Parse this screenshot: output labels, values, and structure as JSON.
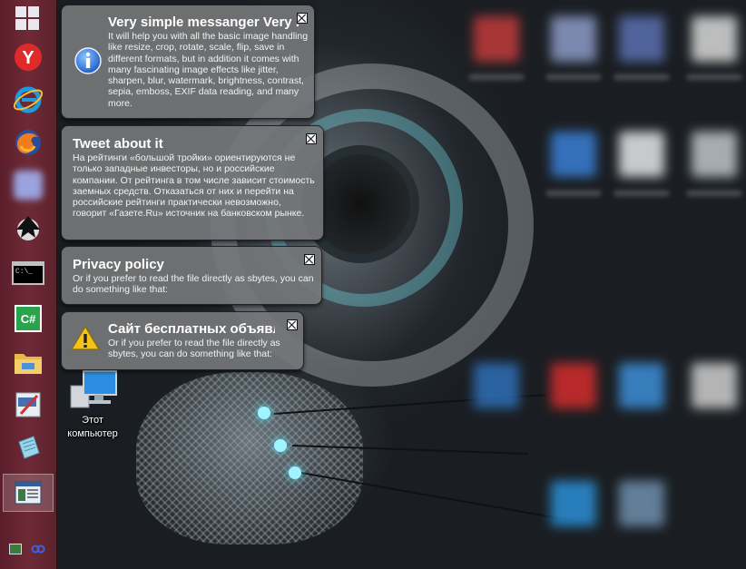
{
  "taskbar": {
    "items": [
      {
        "name": "yandex-browser",
        "icon": "yandex-icon"
      },
      {
        "name": "internet-explorer",
        "icon": "ie-icon"
      },
      {
        "name": "firefox",
        "icon": "firefox-icon"
      },
      {
        "name": "blurred-app",
        "icon": "app-icon"
      },
      {
        "name": "inkscape",
        "icon": "inkscape-icon"
      },
      {
        "name": "command-prompt",
        "icon": "cmd-icon"
      },
      {
        "name": "csharp-editor",
        "icon": "csharp-icon"
      },
      {
        "name": "file-explorer",
        "icon": "folder-icon"
      },
      {
        "name": "image-editor",
        "icon": "editor-icon"
      },
      {
        "name": "notepad",
        "icon": "notepad-icon"
      },
      {
        "name": "messenger-window",
        "icon": "window-icon"
      }
    ],
    "cmd_text": "C:\\_",
    "csharp_text": "C#"
  },
  "desktop": {
    "computer_label_line1": "Этот",
    "computer_label_line2": "компьютер"
  },
  "balloons": [
    {
      "icon": "info-icon",
      "title": "Very simple messanger Very ...",
      "body": "It will help you with all the basic image handling like resize, crop, rotate, scale, flip, save in different formats, but in addition it comes with many fascinating image effects like jitter, sharpen, blur, watermark, brightness, contrast, sepia, emboss, EXIF data reading, and many more."
    },
    {
      "icon": "",
      "title": "Tweet about it",
      "body": "На рейтинги «большой тройки» ориентируются не только западные инвесторы, но и российские компании. От рейтинга в том числе зависит стоимость заемных средств. Отказаться от них и перейти на российские рейтинги практически невозможно, говорит «Газете.Ru» источник на банковском рынке."
    },
    {
      "icon": "",
      "title": "Privacy policy",
      "body": "Or if you prefer to read the file directly as sbytes, you can do something like that:"
    },
    {
      "icon": "warning-icon",
      "title": "Сайт бесплатных объявлений",
      "body": "Or if you prefer to read the file directly as sbytes, you can do something like that:"
    }
  ],
  "colors": {
    "taskbar": "#6e2a36",
    "balloon_bg": "#747678",
    "info_blue": "#1e5fc9",
    "warning_yellow": "#f3c21b"
  }
}
